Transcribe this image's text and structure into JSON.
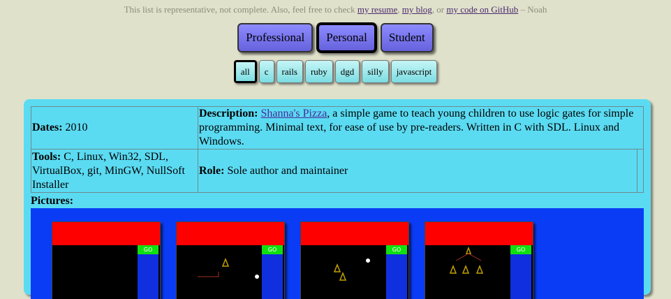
{
  "intro": {
    "prefix": "This list is representative, not complete. Also, feel free to check ",
    "resume_link": "my resume",
    "sep1": ", ",
    "blog_link": "my blog",
    "sep2": ", or ",
    "github_link": "my code on GitHub",
    "suffix": " – Noah"
  },
  "categories": [
    {
      "label": "Professional",
      "active": false
    },
    {
      "label": "Personal",
      "active": true
    },
    {
      "label": "Student",
      "active": false
    }
  ],
  "tags": [
    {
      "label": "all",
      "active": true
    },
    {
      "label": "c",
      "active": false
    },
    {
      "label": "rails",
      "active": false
    },
    {
      "label": "ruby",
      "active": false
    },
    {
      "label": "dgd",
      "active": false
    },
    {
      "label": "silly",
      "active": false
    },
    {
      "label": "javascript",
      "active": false
    }
  ],
  "project": {
    "dates_label": "Dates:",
    "dates_value": " 2010",
    "description_label": "Description:",
    "project_link": "Shanna's Pizza",
    "description_text": ", a simple game to teach young children to use logic gates for simple programming. Minimal text, for ease of use by pre-readers. Written in C with SDL. Linux and Windows.",
    "tools_label": "Tools:",
    "tools_value": " C, Linux, Win32, SDL, VirtualBox, git, MinGW, NullSoft Installer",
    "role_label": "Role:",
    "role_value": " Sole author and maintainer",
    "pictures_label": "Pictures:",
    "screenshots": [
      {
        "go_label": "GO"
      },
      {
        "go_label": "GO"
      },
      {
        "go_label": "GO"
      },
      {
        "go_label": "GO"
      }
    ]
  },
  "colors": {
    "page_bg": "#e0e1cb",
    "category_button": "#7a77f0",
    "tag_button": "#a8ecef",
    "project_panel": "#5bdbf2",
    "pictures_bg": "#0b3cf5",
    "banner": "#ff0000",
    "go": "#10e010"
  }
}
